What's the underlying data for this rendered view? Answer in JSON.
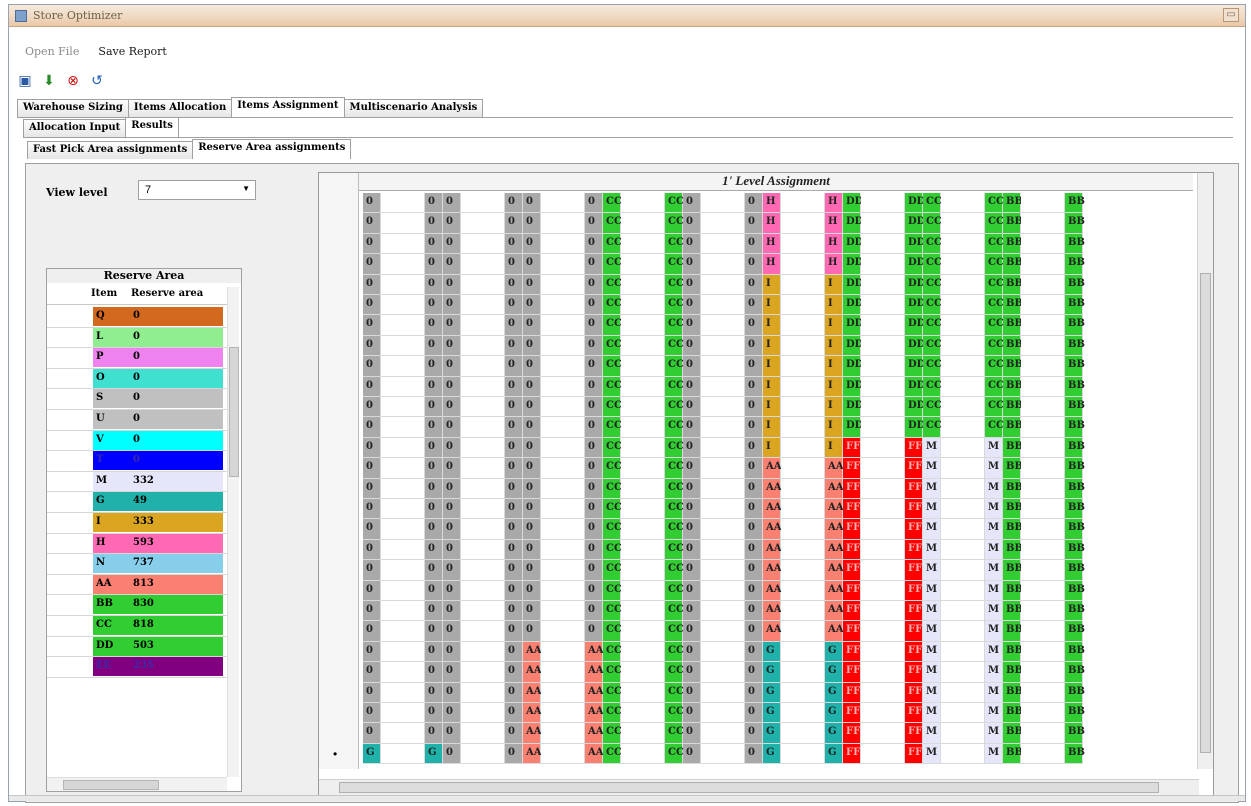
{
  "window": {
    "title": "Store Optimizer"
  },
  "menu": {
    "items": [
      {
        "label": "Open File",
        "disabled": true
      },
      {
        "label": "Save Report",
        "disabled": false
      }
    ]
  },
  "toolbar": {
    "icons": [
      "save-icon",
      "import-icon",
      "stop-icon",
      "undo-icon"
    ]
  },
  "tabs_main": [
    {
      "label": "Warehouse Sizing",
      "active": false
    },
    {
      "label": "Items Allocation",
      "active": false
    },
    {
      "label": "Items Assignment",
      "active": true
    },
    {
      "label": "Multiscenario Analysis",
      "active": false
    }
  ],
  "tabs_sub": [
    {
      "label": "Allocation Input",
      "active": false
    },
    {
      "label": "Results",
      "active": true
    }
  ],
  "tabs_sub2": [
    {
      "label": "Fast Pick Area assignments",
      "active": false
    },
    {
      "label": "Reserve Area assignments",
      "active": true
    }
  ],
  "view": {
    "label": "View level",
    "value": "7"
  },
  "reserve": {
    "caption": "Reserve Area",
    "headers": {
      "item": "Item",
      "area": "Reserve area"
    },
    "rows": [
      {
        "item": "Q",
        "area": "0",
        "color": "#d2691e"
      },
      {
        "item": "L",
        "area": "0",
        "color": "#90ee90"
      },
      {
        "item": "P",
        "area": "0",
        "color": "#ee82ee"
      },
      {
        "item": "O",
        "area": "0",
        "color": "#40e0d0"
      },
      {
        "item": "S",
        "area": "0",
        "color": "#c0c0c0"
      },
      {
        "item": "U",
        "area": "0",
        "color": "#c0c0c0"
      },
      {
        "item": "V",
        "area": "0",
        "color": "#00ffff"
      },
      {
        "item": "T",
        "area": "0",
        "color": "#0000ff"
      },
      {
        "item": "M",
        "area": "332",
        "color": "#e6e6fa"
      },
      {
        "item": "G",
        "area": "49",
        "color": "#20b2aa"
      },
      {
        "item": "I",
        "area": "333",
        "color": "#daa520"
      },
      {
        "item": "H",
        "area": "593",
        "color": "#ff69b4"
      },
      {
        "item": "N",
        "area": "737",
        "color": "#87ceeb"
      },
      {
        "item": "AA",
        "area": "813",
        "color": "#fa8072"
      },
      {
        "item": "BB",
        "area": "830",
        "color": "#32cd32"
      },
      {
        "item": "CC",
        "area": "818",
        "color": "#32cd32"
      },
      {
        "item": "DD",
        "area": "503",
        "color": "#32cd32"
      },
      {
        "item": "EE",
        "area": "235",
        "color": "#800080"
      }
    ]
  },
  "grid": {
    "caption": "1' Level Assignment",
    "colors": {
      "0": "#a9a9a9",
      "CC": "#32cd32",
      "DD": "#32cd32",
      "BB": "#32cd32",
      "H": "#ff69b4",
      "I": "#daa520",
      "AA": "#fa8072",
      "FF": "#ff0000",
      "M": "#e6e6fa",
      "G": "#20b2aa"
    },
    "rows": [
      [
        "0",
        "",
        "0",
        "0",
        "",
        "0",
        "0",
        "",
        "0",
        "CC",
        "",
        "CC",
        "0",
        "",
        "0",
        "H",
        "",
        "H",
        "DD",
        "",
        "DD",
        "CC",
        "",
        "CC",
        "BB",
        "",
        "BB"
      ],
      [
        "0",
        "",
        "0",
        "0",
        "",
        "0",
        "0",
        "",
        "0",
        "CC",
        "",
        "CC",
        "0",
        "",
        "0",
        "H",
        "",
        "H",
        "DD",
        "",
        "DD",
        "CC",
        "",
        "CC",
        "BB",
        "",
        "BB"
      ],
      [
        "0",
        "",
        "0",
        "0",
        "",
        "0",
        "0",
        "",
        "0",
        "CC",
        "",
        "CC",
        "0",
        "",
        "0",
        "H",
        "",
        "H",
        "DD",
        "",
        "DD",
        "CC",
        "",
        "CC",
        "BB",
        "",
        "BB"
      ],
      [
        "0",
        "",
        "0",
        "0",
        "",
        "0",
        "0",
        "",
        "0",
        "CC",
        "",
        "CC",
        "0",
        "",
        "0",
        "H",
        "",
        "H",
        "DD",
        "",
        "DD",
        "CC",
        "",
        "CC",
        "BB",
        "",
        "BB"
      ],
      [
        "0",
        "",
        "0",
        "0",
        "",
        "0",
        "0",
        "",
        "0",
        "CC",
        "",
        "CC",
        "0",
        "",
        "0",
        "I",
        "",
        "I",
        "DD",
        "",
        "DD",
        "CC",
        "",
        "CC",
        "BB",
        "",
        "BB"
      ],
      [
        "0",
        "",
        "0",
        "0",
        "",
        "0",
        "0",
        "",
        "0",
        "CC",
        "",
        "CC",
        "0",
        "",
        "0",
        "I",
        "",
        "I",
        "DD",
        "",
        "DD",
        "CC",
        "",
        "CC",
        "BB",
        "",
        "BB"
      ],
      [
        "0",
        "",
        "0",
        "0",
        "",
        "0",
        "0",
        "",
        "0",
        "CC",
        "",
        "CC",
        "0",
        "",
        "0",
        "I",
        "",
        "I",
        "DD",
        "",
        "DD",
        "CC",
        "",
        "CC",
        "BB",
        "",
        "BB"
      ],
      [
        "0",
        "",
        "0",
        "0",
        "",
        "0",
        "0",
        "",
        "0",
        "CC",
        "",
        "CC",
        "0",
        "",
        "0",
        "I",
        "",
        "I",
        "DD",
        "",
        "DD",
        "CC",
        "",
        "CC",
        "BB",
        "",
        "BB"
      ],
      [
        "0",
        "",
        "0",
        "0",
        "",
        "0",
        "0",
        "",
        "0",
        "CC",
        "",
        "CC",
        "0",
        "",
        "0",
        "I",
        "",
        "I",
        "DD",
        "",
        "DD",
        "CC",
        "",
        "CC",
        "BB",
        "",
        "BB"
      ],
      [
        "0",
        "",
        "0",
        "0",
        "",
        "0",
        "0",
        "",
        "0",
        "CC",
        "",
        "CC",
        "0",
        "",
        "0",
        "I",
        "",
        "I",
        "DD",
        "",
        "DD",
        "CC",
        "",
        "CC",
        "BB",
        "",
        "BB"
      ],
      [
        "0",
        "",
        "0",
        "0",
        "",
        "0",
        "0",
        "",
        "0",
        "CC",
        "",
        "CC",
        "0",
        "",
        "0",
        "I",
        "",
        "I",
        "DD",
        "",
        "DD",
        "CC",
        "",
        "CC",
        "BB",
        "",
        "BB"
      ],
      [
        "0",
        "",
        "0",
        "0",
        "",
        "0",
        "0",
        "",
        "0",
        "CC",
        "",
        "CC",
        "0",
        "",
        "0",
        "I",
        "",
        "I",
        "DD",
        "",
        "DD",
        "CC",
        "",
        "CC",
        "BB",
        "",
        "BB"
      ],
      [
        "0",
        "",
        "0",
        "0",
        "",
        "0",
        "0",
        "",
        "0",
        "CC",
        "",
        "CC",
        "0",
        "",
        "0",
        "I",
        "",
        "I",
        "FF",
        "",
        "FF",
        "M",
        "",
        "M",
        "BB",
        "",
        "BB"
      ],
      [
        "0",
        "",
        "0",
        "0",
        "",
        "0",
        "0",
        "",
        "0",
        "CC",
        "",
        "CC",
        "0",
        "",
        "0",
        "AA",
        "",
        "AA",
        "FF",
        "",
        "FF",
        "M",
        "",
        "M",
        "BB",
        "",
        "BB"
      ],
      [
        "0",
        "",
        "0",
        "0",
        "",
        "0",
        "0",
        "",
        "0",
        "CC",
        "",
        "CC",
        "0",
        "",
        "0",
        "AA",
        "",
        "AA",
        "FF",
        "",
        "FF",
        "M",
        "",
        "M",
        "BB",
        "",
        "BB"
      ],
      [
        "0",
        "",
        "0",
        "0",
        "",
        "0",
        "0",
        "",
        "0",
        "CC",
        "",
        "CC",
        "0",
        "",
        "0",
        "AA",
        "",
        "AA",
        "FF",
        "",
        "FF",
        "M",
        "",
        "M",
        "BB",
        "",
        "BB"
      ],
      [
        "0",
        "",
        "0",
        "0",
        "",
        "0",
        "0",
        "",
        "0",
        "CC",
        "",
        "CC",
        "0",
        "",
        "0",
        "AA",
        "",
        "AA",
        "FF",
        "",
        "FF",
        "M",
        "",
        "M",
        "BB",
        "",
        "BB"
      ],
      [
        "0",
        "",
        "0",
        "0",
        "",
        "0",
        "0",
        "",
        "0",
        "CC",
        "",
        "CC",
        "0",
        "",
        "0",
        "AA",
        "",
        "AA",
        "FF",
        "",
        "FF",
        "M",
        "",
        "M",
        "BB",
        "",
        "BB"
      ],
      [
        "0",
        "",
        "0",
        "0",
        "",
        "0",
        "0",
        "",
        "0",
        "CC",
        "",
        "CC",
        "0",
        "",
        "0",
        "AA",
        "",
        "AA",
        "FF",
        "",
        "FF",
        "M",
        "",
        "M",
        "BB",
        "",
        "BB"
      ],
      [
        "0",
        "",
        "0",
        "0",
        "",
        "0",
        "0",
        "",
        "0",
        "CC",
        "",
        "CC",
        "0",
        "",
        "0",
        "AA",
        "",
        "AA",
        "FF",
        "",
        "FF",
        "M",
        "",
        "M",
        "BB",
        "",
        "BB"
      ],
      [
        "0",
        "",
        "0",
        "0",
        "",
        "0",
        "0",
        "",
        "0",
        "CC",
        "",
        "CC",
        "0",
        "",
        "0",
        "AA",
        "",
        "AA",
        "FF",
        "",
        "FF",
        "M",
        "",
        "M",
        "BB",
        "",
        "BB"
      ],
      [
        "0",
        "",
        "0",
        "0",
        "",
        "0",
        "0",
        "",
        "0",
        "CC",
        "",
        "CC",
        "0",
        "",
        "0",
        "AA",
        "",
        "AA",
        "FF",
        "",
        "FF",
        "M",
        "",
        "M",
        "BB",
        "",
        "BB"
      ],
      [
        "0",
        "",
        "0",
        "0",
        "",
        "0",
        "AA",
        "",
        "AA",
        "CC",
        "",
        "CC",
        "0",
        "",
        "0",
        "G",
        "",
        "G",
        "FF",
        "",
        "FF",
        "M",
        "",
        "M",
        "BB",
        "",
        "BB"
      ],
      [
        "0",
        "",
        "0",
        "0",
        "",
        "0",
        "AA",
        "",
        "AA",
        "CC",
        "",
        "CC",
        "0",
        "",
        "0",
        "G",
        "",
        "G",
        "FF",
        "",
        "FF",
        "M",
        "",
        "M",
        "BB",
        "",
        "BB"
      ],
      [
        "0",
        "",
        "0",
        "0",
        "",
        "0",
        "AA",
        "",
        "AA",
        "CC",
        "",
        "CC",
        "0",
        "",
        "0",
        "G",
        "",
        "G",
        "FF",
        "",
        "FF",
        "M",
        "",
        "M",
        "BB",
        "",
        "BB"
      ],
      [
        "0",
        "",
        "0",
        "0",
        "",
        "0",
        "AA",
        "",
        "AA",
        "CC",
        "",
        "CC",
        "0",
        "",
        "0",
        "G",
        "",
        "G",
        "FF",
        "",
        "FF",
        "M",
        "",
        "M",
        "BB",
        "",
        "BB"
      ],
      [
        "0",
        "",
        "0",
        "0",
        "",
        "0",
        "AA",
        "",
        "AA",
        "CC",
        "",
        "CC",
        "0",
        "",
        "0",
        "G",
        "",
        "G",
        "FF",
        "",
        "FF",
        "M",
        "",
        "M",
        "BB",
        "",
        "BB"
      ],
      [
        "G",
        "",
        "G",
        "0",
        "",
        "0",
        "AA",
        "",
        "AA",
        "CC",
        "",
        "CC",
        "0",
        "",
        "0",
        "G",
        "",
        "G",
        "FF",
        "",
        "FF",
        "M",
        "",
        "M",
        "BB",
        "",
        "BB"
      ]
    ]
  }
}
